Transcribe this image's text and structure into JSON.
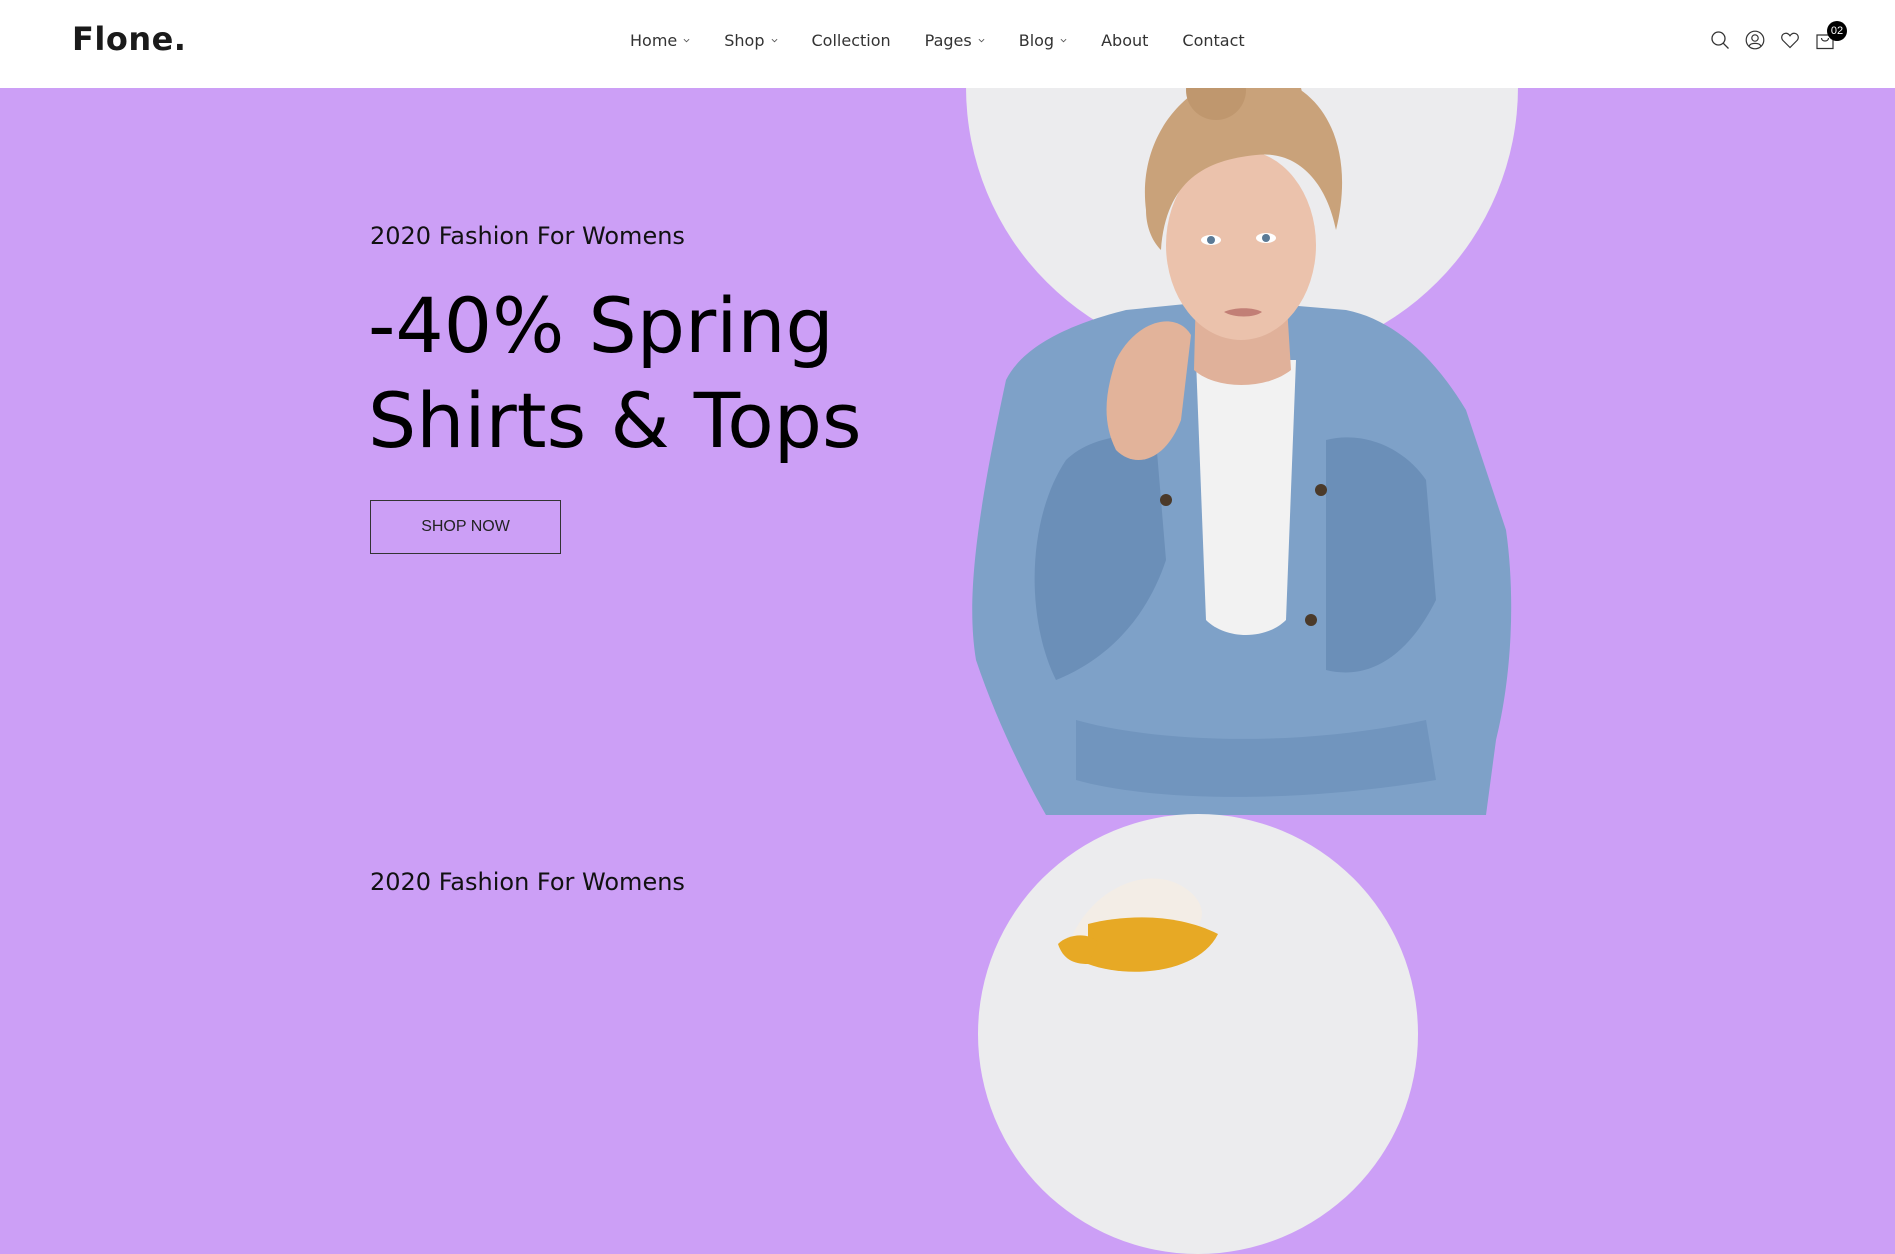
{
  "brand": {
    "logo": "Flone."
  },
  "nav": {
    "items": [
      {
        "label": "Home",
        "dropdown": true
      },
      {
        "label": "Shop",
        "dropdown": true
      },
      {
        "label": "Collection",
        "dropdown": false
      },
      {
        "label": "Pages",
        "dropdown": true
      },
      {
        "label": "Blog",
        "dropdown": true
      },
      {
        "label": "About",
        "dropdown": false
      },
      {
        "label": "Contact",
        "dropdown": false
      }
    ]
  },
  "header_icons": {
    "search": "search-icon",
    "account": "user-icon",
    "wishlist": "heart-icon",
    "cart": "shopping-bag-icon",
    "cart_count": "02"
  },
  "hero": {
    "subtitle": "2020 Fashion For Womens",
    "headline_line1": "-40% Spring",
    "headline_line2": "Shirts & Tops",
    "button_label": "SHOP NOW",
    "background_color": "#cc9ff6"
  },
  "next_slide": {
    "subtitle": "2020 Fashion For Womens"
  }
}
